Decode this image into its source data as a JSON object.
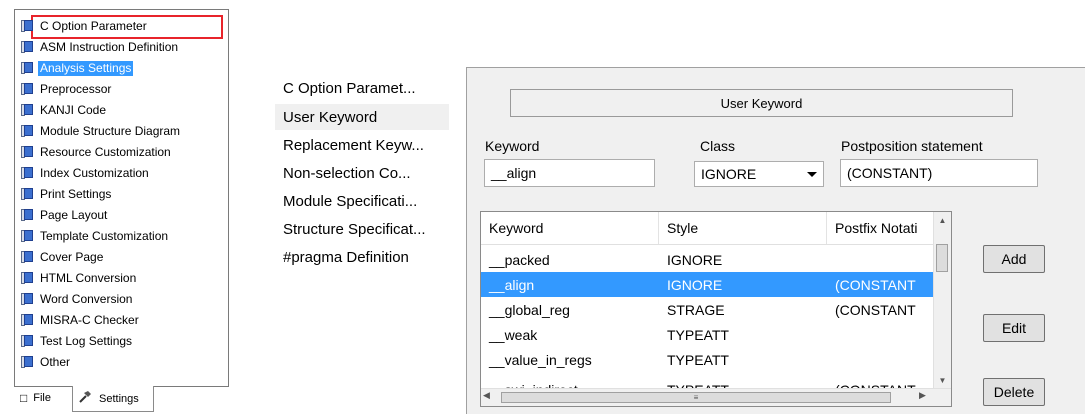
{
  "tree": {
    "items": [
      {
        "label": "C Option Parameter"
      },
      {
        "label": "ASM Instruction Definition"
      },
      {
        "label": "Analysis Settings"
      },
      {
        "label": "Preprocessor"
      },
      {
        "label": "KANJI Code"
      },
      {
        "label": "Module Structure Diagram"
      },
      {
        "label": "Resource Customization"
      },
      {
        "label": "Index Customization"
      },
      {
        "label": "Print Settings"
      },
      {
        "label": "Page Layout"
      },
      {
        "label": "Template Customization"
      },
      {
        "label": "Cover Page"
      },
      {
        "label": "HTML Conversion"
      },
      {
        "label": "Word Conversion"
      },
      {
        "label": "MISRA-C Checker"
      },
      {
        "label": "Test Log Settings"
      },
      {
        "label": "Other"
      }
    ],
    "selected_index": 2,
    "highlighted_index": 0
  },
  "bottom_tabs": {
    "file": "File",
    "settings": "Settings"
  },
  "middle_list": {
    "items": [
      "C Option Paramet...",
      "User Keyword",
      "Replacement Keyw...",
      "Non-selection Co...",
      "Module Specificati...",
      "Structure Specificat...",
      "#pragma Definition"
    ],
    "active_index": 1
  },
  "panel": {
    "header": "User Keyword",
    "keyword_label": "Keyword",
    "keyword_value": "__align",
    "class_label": "Class",
    "class_value": "IGNORE",
    "postposition_label": "Postposition statement",
    "postposition_value": "(CONSTANT)"
  },
  "table": {
    "columns": [
      "Keyword",
      "Style",
      "Postfix Notati"
    ],
    "rows": [
      [
        "__packed",
        "IGNORE",
        ""
      ],
      [
        "__align",
        "IGNORE",
        "(CONSTANT"
      ],
      [
        "__global_reg",
        "STRAGE",
        "(CONSTANT"
      ],
      [
        "__weak",
        "TYPEATT",
        ""
      ],
      [
        "__value_in_regs",
        "TYPEATT",
        ""
      ],
      [
        "__swi_indirect",
        "TYPEATT",
        "(CONSTANT"
      ]
    ],
    "selected_row": 1
  },
  "buttons": {
    "add": "Add",
    "edit": "Edit",
    "delete": "Delete"
  },
  "colors": {
    "selection": "#3399ff",
    "highlight_border": "#e8242b",
    "panel_bg": "#f0f0f0"
  }
}
